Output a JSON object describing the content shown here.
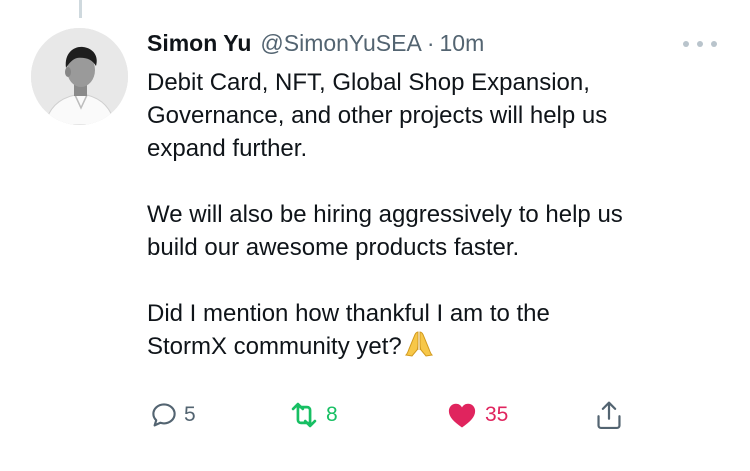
{
  "tweet": {
    "author": {
      "display_name": "Simon Yu",
      "handle": "@SimonYuSEA",
      "separator": "·",
      "timestamp": "10m"
    },
    "paragraphs": [
      "Debit Card, NFT, Global Shop Expansion,\nGovernance, and other projects will help us\nexpand further.",
      "We will also be hiring aggressively to help us\nbuild our awesome products faster.",
      "Did I mention how thankful I am to the\nStormX community yet?"
    ],
    "emoji": "folded-hands"
  },
  "actions": {
    "reply": {
      "count": "5",
      "icon": "reply-icon",
      "color": "#536471"
    },
    "retweet": {
      "count": "8",
      "icon": "retweet-icon",
      "color": "#17bf63",
      "active": true
    },
    "like": {
      "count": "35",
      "icon": "heart-icon",
      "color": "#e0245e",
      "active": true
    },
    "share": {
      "icon": "share-icon",
      "color": "#536471"
    }
  }
}
